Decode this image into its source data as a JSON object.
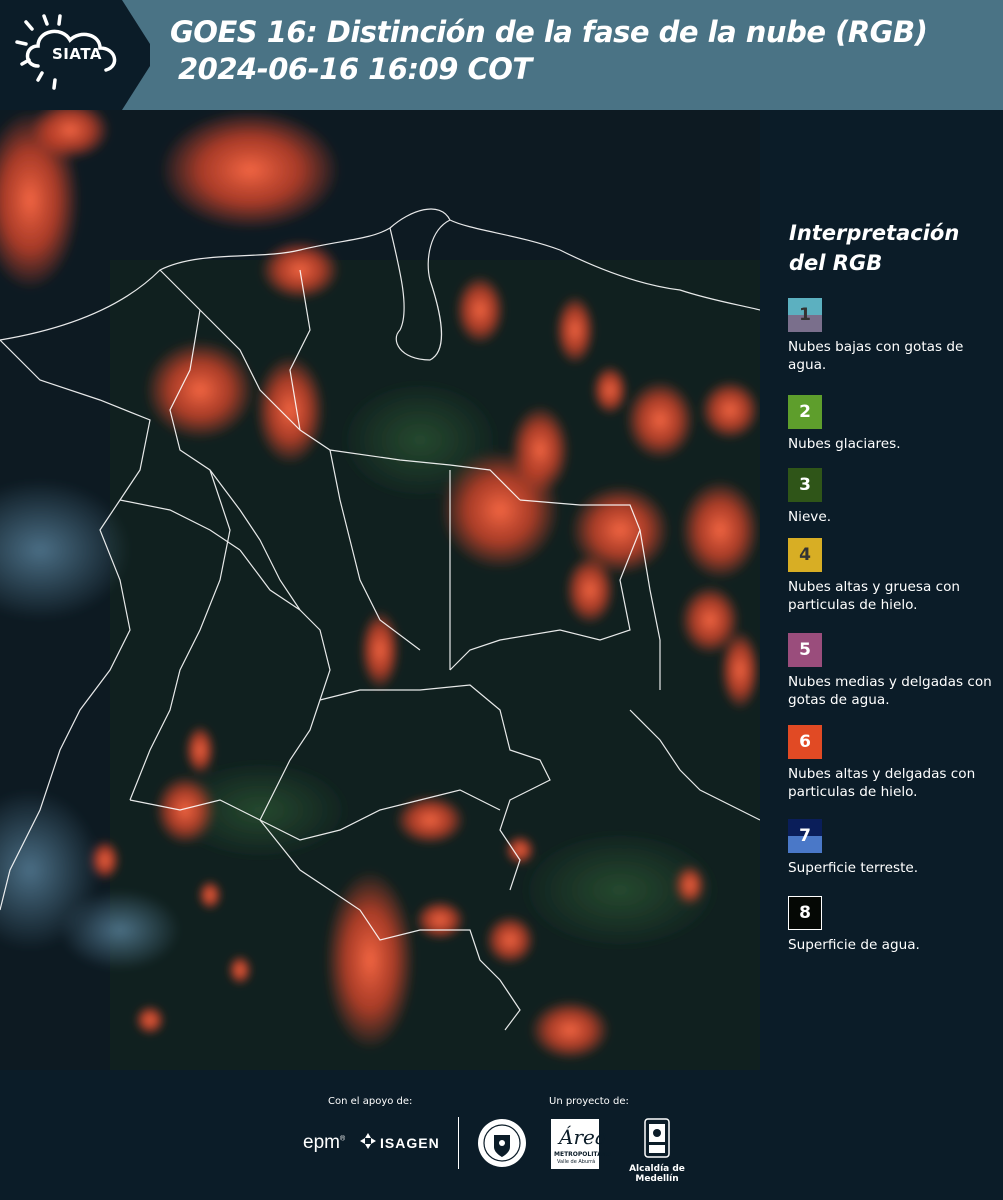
{
  "header": {
    "logo_text": "SIATA",
    "title_line1": "GOES 16: Distinción de la fase de la nube (RGB)",
    "title_line2": "2024-06-16 16:09 COT"
  },
  "map": {
    "icon": "satellite-rgb-map"
  },
  "legend": {
    "title": "Interpretación del RGB",
    "items": [
      {
        "num": "1",
        "label": "Nubes bajas con gotas de agua.",
        "color_top": "#5cb0c0",
        "color_bottom": "#7a6f8c",
        "num_color": "#333333"
      },
      {
        "num": "2",
        "label": "Nubes glaciares.",
        "color_top": "#5e9e2c",
        "color_bottom": "#5e9e2c",
        "num_color": "#ffffff"
      },
      {
        "num": "3",
        "label": "Nieve.",
        "color_top": "#2f5518",
        "color_bottom": "#2f5518",
        "num_color": "#ffffff"
      },
      {
        "num": "4",
        "label": "Nubes altas y gruesa con particulas de hielo.",
        "color_top": "#d8ae24",
        "color_bottom": "#d8ae24",
        "num_color": "#333333"
      },
      {
        "num": "5",
        "label": "Nubes medias y delgadas con gotas de agua.",
        "color_top": "#9a4d7c",
        "color_bottom": "#9a4d7c",
        "num_color": "#ffffff"
      },
      {
        "num": "6",
        "label": "Nubes altas y delgadas con particulas de hielo.",
        "color_top": "#e14a24",
        "color_bottom": "#e14a24",
        "num_color": "#ffffff"
      },
      {
        "num": "7",
        "label": "Superficie terreste.",
        "color_top": "#0a1e5a",
        "color_bottom": "#4a78c8",
        "num_color": "#ffffff"
      },
      {
        "num": "8",
        "label": "Superficie de agua.",
        "color_top": "#050805",
        "color_bottom": "#050805",
        "num_color": "#ffffff"
      }
    ]
  },
  "footer": {
    "support_label": "Con el apoyo de:",
    "project_label": "Un proyecto de:",
    "epm": "epm",
    "epm_mark": "®",
    "isagen": "ISAGEN",
    "area_script": "Área",
    "area_line1": "METROPOLITANA",
    "area_line2": "Valle de Aburrá",
    "alcaldia": "Alcaldía de Medellín"
  },
  "colors": {
    "header_bg": "#4a7385",
    "page_bg": "#0b1c28",
    "cloud_red": "#ff5a36",
    "border_line": "#ffffff"
  }
}
